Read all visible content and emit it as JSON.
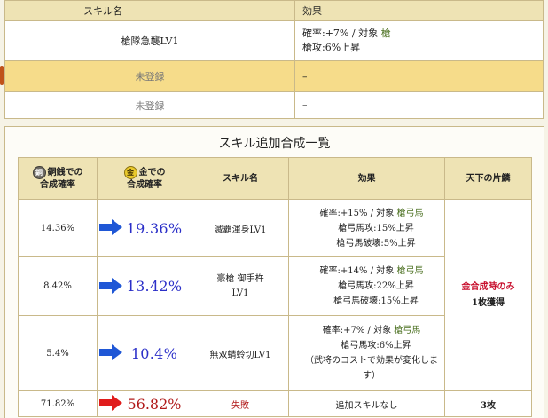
{
  "skill_table": {
    "header": {
      "name": "スキル名",
      "effect": "効果"
    },
    "rows": [
      {
        "name": "槍隊急襲LV1",
        "effect_rate": "確率:+7%",
        "effect_sep": " / ",
        "effect_target_label": "対象",
        "effect_target": "槍",
        "effect_line2": "槍攻:6%上昇"
      },
      {
        "name": "未登録",
        "effect": "–"
      },
      {
        "name": "未登録",
        "effect": "–"
      }
    ]
  },
  "panel": {
    "title": "スキル追加合成一覧",
    "headers": {
      "copper": "銅銭での\n合成確率",
      "copper_icon": "銅",
      "gold": "金での\n合成確率",
      "gold_icon": "金",
      "skill": "スキル名",
      "effect": "効果",
      "tenka": "天下の片鱗"
    },
    "rows": [
      {
        "copper": "14.36%",
        "gold": "19.36%",
        "skill": "滅覇渾身LV1",
        "eff1_rate": "確率:+15%",
        "eff1_target_label": "対象",
        "eff1_target": "槍弓馬",
        "eff2": "槍弓馬攻:15%上昇",
        "eff3": "槍弓馬破壊:5%上昇"
      },
      {
        "copper": "8.42%",
        "gold": "13.42%",
        "skill": "豪槍 御手杵\nLV1",
        "eff1_rate": "確率:+14%",
        "eff1_target_label": "対象",
        "eff1_target": "槍弓馬",
        "eff2": "槍弓馬攻:22%上昇",
        "eff3": "槍弓馬破壊:15%上昇"
      },
      {
        "copper": "5.4%",
        "gold": "10.4%",
        "skill": "無双蜻蛉切LV1",
        "eff1_rate": "確率:+7%",
        "eff1_target_label": "対象",
        "eff1_target": "槍弓馬",
        "eff2": "槍弓馬攻:6%上昇",
        "eff3": "（武将のコストで効果が変化します）"
      }
    ],
    "tenka_note_line1": "金合成時のみ",
    "tenka_note_line2": "1枚獲得",
    "fail_row": {
      "copper": "71.82%",
      "gold": "56.82%",
      "skill": "失敗",
      "effect": "追加スキルなし",
      "tenka": "3枚"
    }
  },
  "colors": {
    "blue_arrow": "#1f57d6",
    "red_arrow": "#e01c1c",
    "header_bg": "#eee3b4",
    "highlight_row": "#f6dc8a"
  }
}
